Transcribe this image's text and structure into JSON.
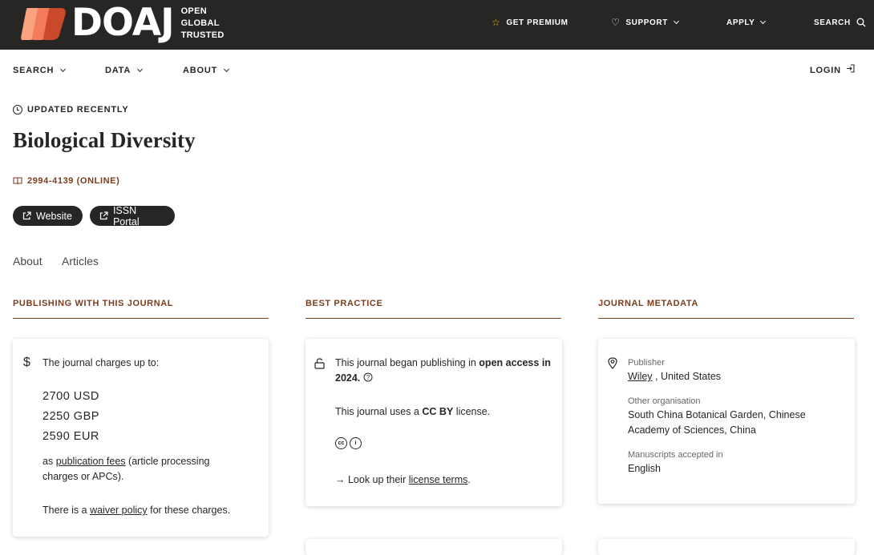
{
  "header": {
    "logo_word": "DOAJ",
    "logo_tagline": [
      "OPEN",
      "GLOBAL",
      "TRUSTED"
    ],
    "nav": {
      "premium": "GET PREMIUM",
      "support": "SUPPORT",
      "apply": "APPLY",
      "search": "SEARCH"
    }
  },
  "subnav": {
    "search": "SEARCH",
    "data": "DATA",
    "about": "ABOUT",
    "login": "LOGIN"
  },
  "journal": {
    "status": "UPDATED RECENTLY",
    "title": "Biological Diversity",
    "issn": "2994-4139 (ONLINE)",
    "buttons": {
      "website": "Website",
      "issn_portal": "ISSN Portal"
    },
    "tabs": {
      "about": "About",
      "articles": "Articles"
    }
  },
  "columns": {
    "publishing": {
      "heading": "PUBLISHING WITH THIS JOURNAL",
      "charges_intro": "The journal charges up to:",
      "charges": [
        "2700 USD",
        "2250 GBP",
        "2590 EUR"
      ],
      "fees_prefix": "as",
      "fees_link": "publication fees",
      "fees_suffix": "(article processing charges or APCs).",
      "waiver_prefix": "There is a",
      "waiver_link": "waiver policy",
      "waiver_suffix": "for these charges."
    },
    "best_practice": {
      "heading": "BEST PRACTICE",
      "oa_prefix": "This journal began publishing in",
      "oa_bold": "open access in 2024.",
      "license_prefix": "This journal uses a",
      "license_bold": "CC BY",
      "license_suffix": "license.",
      "lookup_prefix": "→ Look up their",
      "lookup_link": "license terms",
      "lookup_suffix": "."
    },
    "metadata": {
      "heading": "JOURNAL METADATA",
      "publisher_label": "Publisher",
      "publisher_link": "Wiley",
      "publisher_country": ", United States",
      "other_org_label": "Other organisation",
      "other_org": "South China Botanical Garden, Chinese Academy of Sciences, China",
      "manuscripts_label": "Manuscripts accepted in",
      "manuscripts_lang": "English"
    }
  },
  "colors": {
    "topbar": "#282624",
    "accent": "#7a3d1e",
    "logo_orange": "#f47c5c",
    "star": "#e8b828"
  },
  "icons": [
    "star-icon",
    "heart-icon",
    "search-icon",
    "login-icon",
    "clock-icon",
    "book-icon",
    "external-link-icon",
    "dollar-icon",
    "unlock-icon",
    "help-icon",
    "cc-icon",
    "by-icon",
    "map-pin-icon"
  ]
}
